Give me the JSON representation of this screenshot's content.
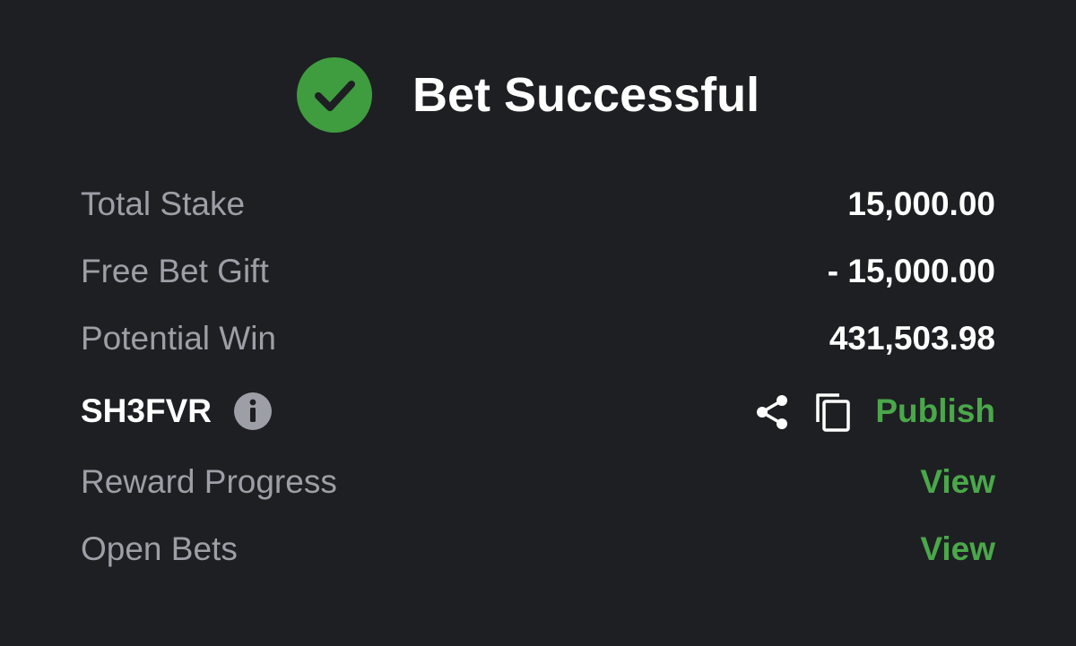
{
  "header": {
    "title": "Bet Successful",
    "icon": "check-circle-icon",
    "accent_color": "#3f9d3f"
  },
  "summary": {
    "total_stake_label": "Total Stake",
    "total_stake_value": "15,000.00",
    "free_bet_label": "Free Bet Gift",
    "free_bet_value": "- 15,000.00",
    "potential_win_label": "Potential Win",
    "potential_win_value": "431,503.98"
  },
  "booking": {
    "code": "SH3FVR",
    "info_icon": "info-icon",
    "share_icon": "share-icon",
    "copy_icon": "copy-icon",
    "publish_label": "Publish"
  },
  "links": {
    "reward_progress_label": "Reward Progress",
    "reward_progress_action": "View",
    "open_bets_label": "Open Bets",
    "open_bets_action": "View"
  },
  "colors": {
    "background": "#1e1f23",
    "label_text": "#9d9fa6",
    "value_text": "#ffffff",
    "link_green": "#4aa84a"
  }
}
